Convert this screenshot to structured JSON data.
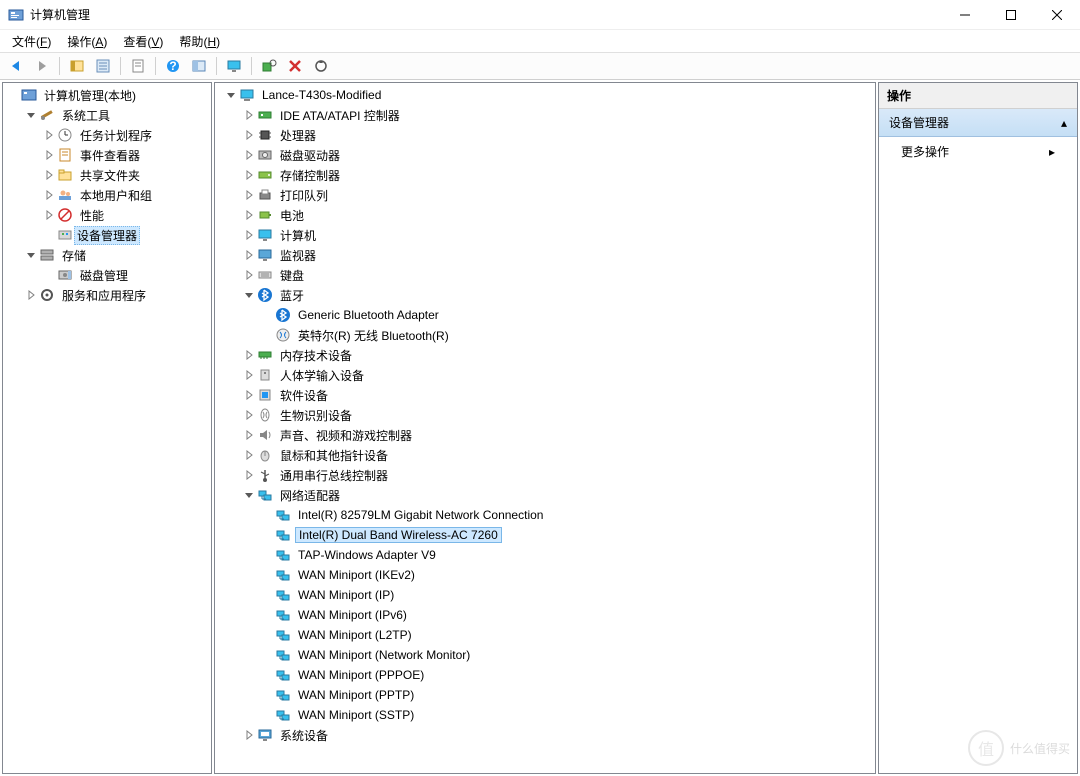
{
  "window": {
    "title": "计算机管理"
  },
  "menu": {
    "file": {
      "label": "文件",
      "accel": "F"
    },
    "action": {
      "label": "操作",
      "accel": "A"
    },
    "view": {
      "label": "查看",
      "accel": "V"
    },
    "help": {
      "label": "帮助",
      "accel": "H"
    }
  },
  "toolbar": {
    "back": "back-arrow",
    "forward": "forward-arrow",
    "up": "folder-up",
    "properties": "properties",
    "refresh": "refresh",
    "help": "help",
    "console": "console",
    "monitor": "monitor",
    "device": "device",
    "remove": "remove",
    "scan": "scan"
  },
  "leftTree": [
    {
      "d": 0,
      "exp": "",
      "icon": "console",
      "label": "计算机管理(本地)"
    },
    {
      "d": 1,
      "exp": "open",
      "icon": "tools",
      "label": "系统工具"
    },
    {
      "d": 2,
      "exp": "closed",
      "icon": "sched",
      "label": "任务计划程序"
    },
    {
      "d": 2,
      "exp": "closed",
      "icon": "event",
      "label": "事件查看器"
    },
    {
      "d": 2,
      "exp": "closed",
      "icon": "share",
      "label": "共享文件夹"
    },
    {
      "d": 2,
      "exp": "closed",
      "icon": "users",
      "label": "本地用户和组"
    },
    {
      "d": 2,
      "exp": "closed",
      "icon": "perf",
      "label": "性能"
    },
    {
      "d": 2,
      "exp": "",
      "icon": "devmgr",
      "label": "设备管理器",
      "selected": true
    },
    {
      "d": 1,
      "exp": "open",
      "icon": "storage",
      "label": "存储"
    },
    {
      "d": 2,
      "exp": "",
      "icon": "disk",
      "label": "磁盘管理"
    },
    {
      "d": 1,
      "exp": "closed",
      "icon": "services",
      "label": "服务和应用程序"
    }
  ],
  "midTree": [
    {
      "d": 0,
      "exp": "open",
      "icon": "pc",
      "label": "Lance-T430s-Modified"
    },
    {
      "d": 1,
      "exp": "closed",
      "icon": "ide",
      "label": "IDE ATA/ATAPI 控制器"
    },
    {
      "d": 1,
      "exp": "closed",
      "icon": "cpu",
      "label": "处理器"
    },
    {
      "d": 1,
      "exp": "closed",
      "icon": "diskdrv",
      "label": "磁盘驱动器"
    },
    {
      "d": 1,
      "exp": "closed",
      "icon": "storctrl",
      "label": "存储控制器"
    },
    {
      "d": 1,
      "exp": "closed",
      "icon": "printq",
      "label": "打印队列"
    },
    {
      "d": 1,
      "exp": "closed",
      "icon": "battery",
      "label": "电池"
    },
    {
      "d": 1,
      "exp": "closed",
      "icon": "computer",
      "label": "计算机"
    },
    {
      "d": 1,
      "exp": "closed",
      "icon": "monitor",
      "label": "监视器"
    },
    {
      "d": 1,
      "exp": "closed",
      "icon": "keyboard",
      "label": "键盘"
    },
    {
      "d": 1,
      "exp": "open",
      "icon": "bt",
      "label": "蓝牙"
    },
    {
      "d": 2,
      "exp": "",
      "icon": "bt",
      "label": "Generic Bluetooth Adapter"
    },
    {
      "d": 2,
      "exp": "",
      "icon": "btradio",
      "label": "英特尔(R) 无线 Bluetooth(R)"
    },
    {
      "d": 1,
      "exp": "closed",
      "icon": "memory",
      "label": "内存技术设备"
    },
    {
      "d": 1,
      "exp": "closed",
      "icon": "hid",
      "label": "人体学输入设备"
    },
    {
      "d": 1,
      "exp": "closed",
      "icon": "soft",
      "label": "软件设备"
    },
    {
      "d": 1,
      "exp": "closed",
      "icon": "bio",
      "label": "生物识别设备"
    },
    {
      "d": 1,
      "exp": "closed",
      "icon": "audio",
      "label": "声音、视频和游戏控制器"
    },
    {
      "d": 1,
      "exp": "closed",
      "icon": "mouse",
      "label": "鼠标和其他指针设备"
    },
    {
      "d": 1,
      "exp": "closed",
      "icon": "usb",
      "label": "通用串行总线控制器"
    },
    {
      "d": 1,
      "exp": "open",
      "icon": "net",
      "label": "网络适配器"
    },
    {
      "d": 2,
      "exp": "",
      "icon": "net",
      "label": "Intel(R) 82579LM Gigabit Network Connection"
    },
    {
      "d": 2,
      "exp": "",
      "icon": "net",
      "label": "Intel(R) Dual Band Wireless-AC 7260",
      "selected": true
    },
    {
      "d": 2,
      "exp": "",
      "icon": "net",
      "label": "TAP-Windows Adapter V9"
    },
    {
      "d": 2,
      "exp": "",
      "icon": "net",
      "label": "WAN Miniport (IKEv2)"
    },
    {
      "d": 2,
      "exp": "",
      "icon": "net",
      "label": "WAN Miniport (IP)"
    },
    {
      "d": 2,
      "exp": "",
      "icon": "net",
      "label": "WAN Miniport (IPv6)"
    },
    {
      "d": 2,
      "exp": "",
      "icon": "net",
      "label": "WAN Miniport (L2TP)"
    },
    {
      "d": 2,
      "exp": "",
      "icon": "net",
      "label": "WAN Miniport (Network Monitor)"
    },
    {
      "d": 2,
      "exp": "",
      "icon": "net",
      "label": "WAN Miniport (PPPOE)"
    },
    {
      "d": 2,
      "exp": "",
      "icon": "net",
      "label": "WAN Miniport (PPTP)"
    },
    {
      "d": 2,
      "exp": "",
      "icon": "net",
      "label": "WAN Miniport (SSTP)"
    },
    {
      "d": 1,
      "exp": "closed",
      "icon": "sysdev",
      "label": "系统设备"
    }
  ],
  "actions": {
    "header": "操作",
    "section": "设备管理器",
    "more": "更多操作"
  },
  "watermark": {
    "char": "值",
    "text": "什么值得买"
  }
}
